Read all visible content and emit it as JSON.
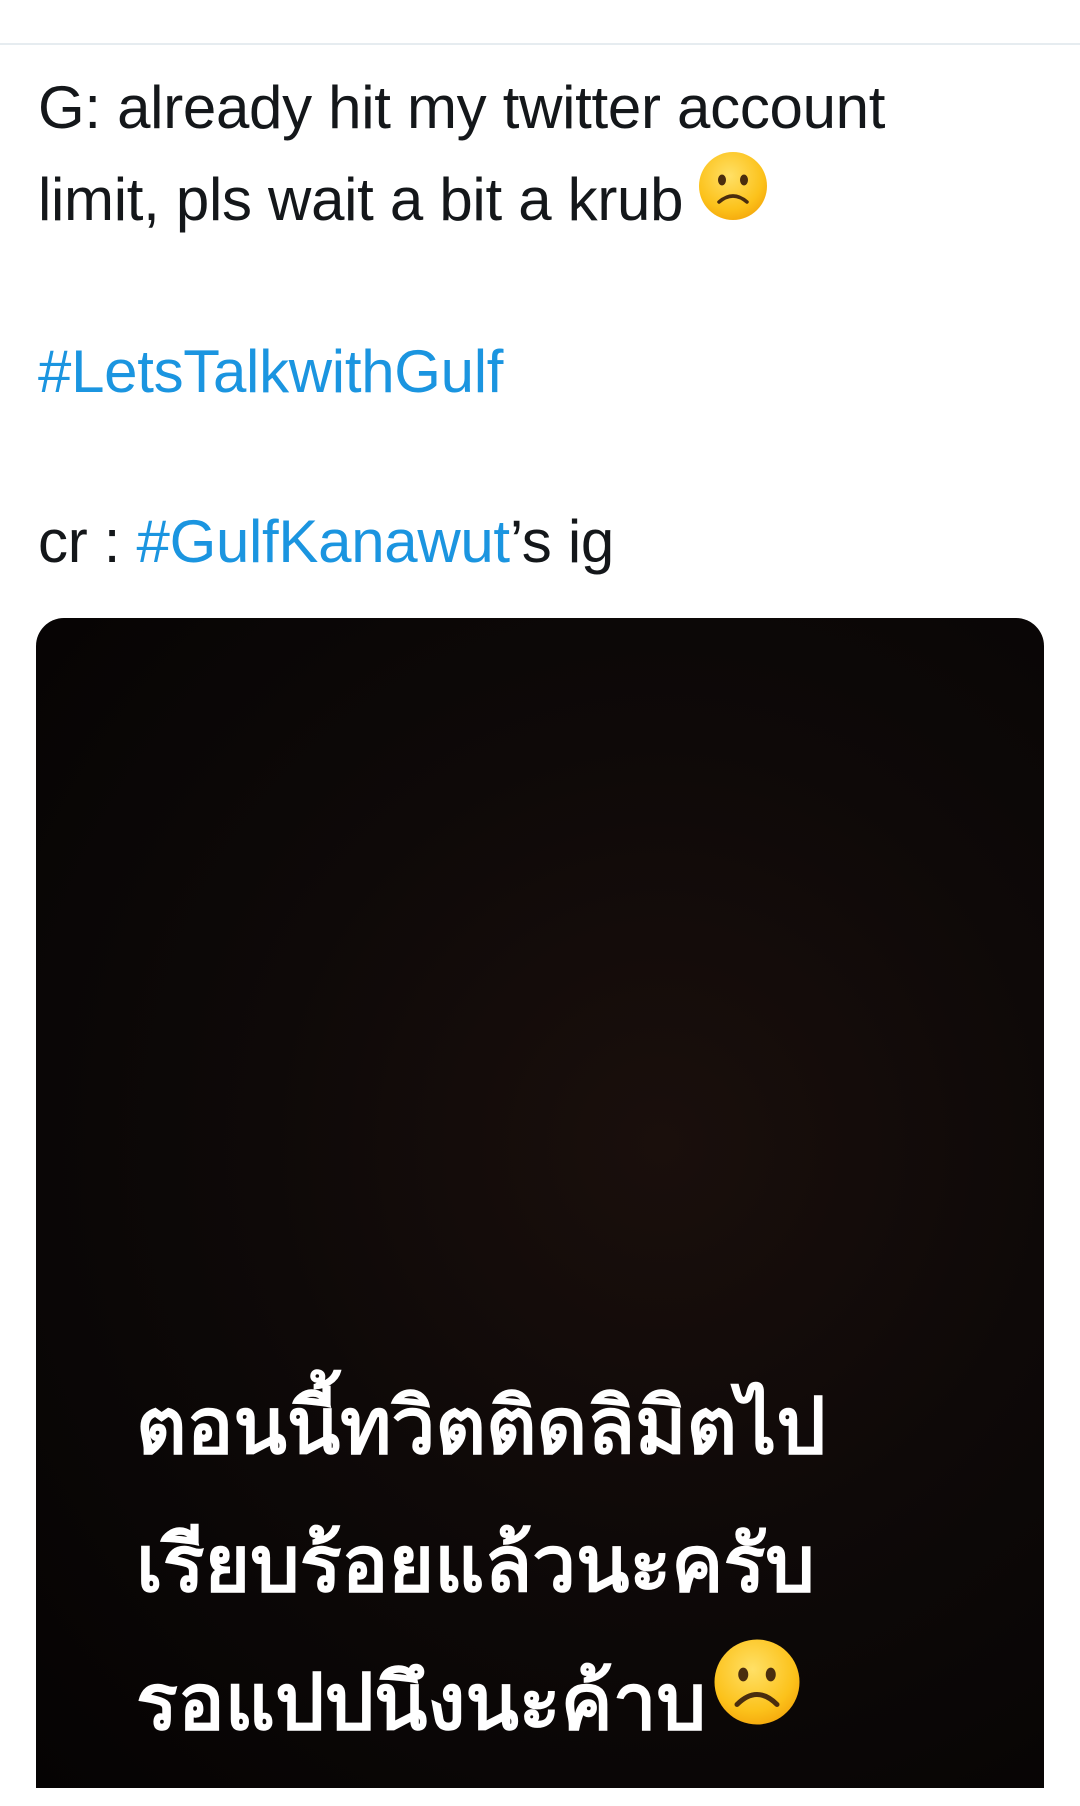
{
  "tweet": {
    "line1": "G: already hit my twitter account",
    "line2": "limit, pls wait a bit a krub",
    "line2_emoji": "slightly-frowning-face-icon",
    "hashtag_line": "#LetsTalkwithGulf",
    "credit_prefix": "cr : ",
    "credit_hashtag": "#GulfKanawut",
    "credit_suffix": "’s ig",
    "hashtag_color": "#1b95e0"
  },
  "media": {
    "story_line1": "ตอนนี้ทวิตติดลิมิตไป",
    "story_line2": "เรียบร้อยแล้วนะครับ",
    "story_line3": "รอแปปนึงนะค้าบ",
    "story_emoji": "frowning-face-icon",
    "background_color": "#0e0908"
  }
}
